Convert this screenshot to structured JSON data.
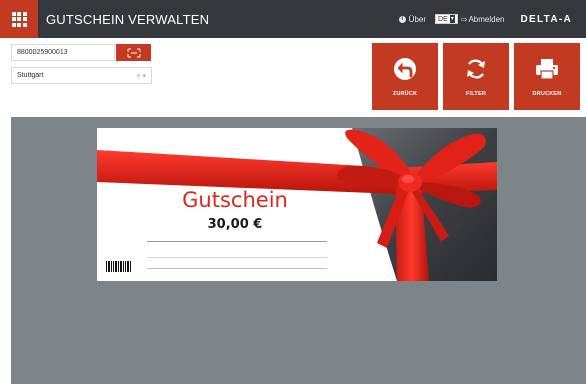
{
  "topbar": {
    "title": "GUTSCHEIN VERWALTEN",
    "about_label": "Über",
    "language_value": "DE",
    "logout_label": "Abmelden",
    "brand": "DELTA-A",
    "accent_color": "#c33a22",
    "bar_color": "#34383d"
  },
  "controls": {
    "voucher_number": "8800025900013",
    "location": "Stuttgart",
    "scan_icon": "barcode-scan-icon"
  },
  "actions": [
    {
      "label": "ZURÜCK",
      "icon": "back-icon"
    },
    {
      "label": "FILTER",
      "icon": "refresh-icon"
    },
    {
      "label": "DRUCKEN",
      "icon": "printer-icon"
    }
  ],
  "voucher": {
    "title": "Gutschein",
    "amount": "30,00 €"
  }
}
